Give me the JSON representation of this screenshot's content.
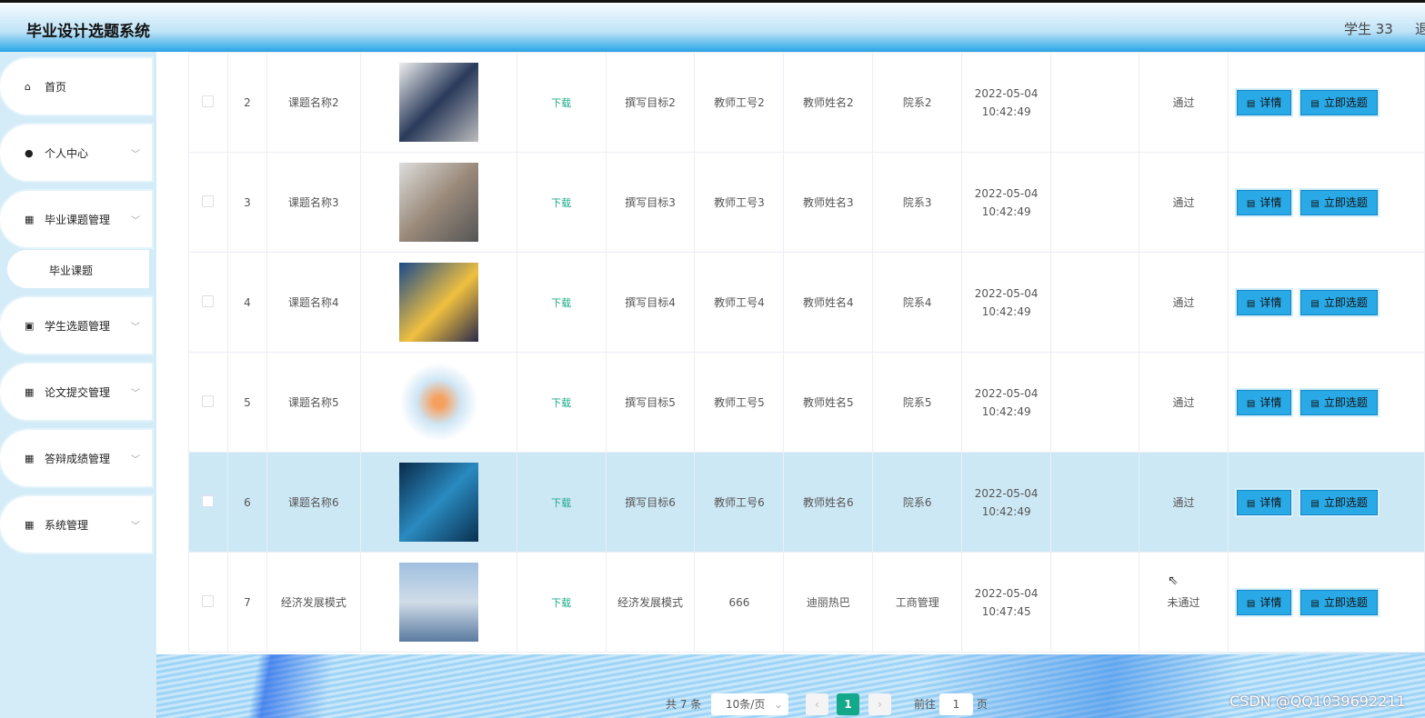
{
  "header": {
    "title": "毕业设计选题系统",
    "user": "学生 33",
    "logout": "退"
  },
  "sidebar": {
    "items": [
      {
        "label": "首页",
        "icon": "home-icon",
        "glyph": "⌂",
        "chevron": false
      },
      {
        "label": "个人中心",
        "icon": "user-icon",
        "glyph": "●",
        "chevron": true
      },
      {
        "label": "毕业课题管理",
        "icon": "grid-icon",
        "glyph": "▦",
        "chevron": true
      },
      {
        "label": "学生选题管理",
        "icon": "clipboard-icon",
        "glyph": "▣",
        "chevron": true
      },
      {
        "label": "论文提交管理",
        "icon": "grid-icon",
        "glyph": "▦",
        "chevron": true
      },
      {
        "label": "答辩成绩管理",
        "icon": "grid-icon",
        "glyph": "▦",
        "chevron": true
      },
      {
        "label": "系统管理",
        "icon": "grid-icon",
        "glyph": "▦",
        "chevron": true
      }
    ],
    "sub_item": "毕业课题"
  },
  "table": {
    "download_label": "下载",
    "detail_label": "详情",
    "select_label": "立即选题",
    "rows": [
      {
        "index": "2",
        "name": "课题名称2",
        "goal": "撰写目标2",
        "teacher_id": "教师工号2",
        "teacher_name": "教师姓名2",
        "dept": "院系2",
        "time": "2022-05-04 10:42:49",
        "status": "通过",
        "img": "linear-gradient(135deg,#eee,#2a3a5a 50%,#bbb)"
      },
      {
        "index": "3",
        "name": "课题名称3",
        "goal": "撰写目标3",
        "teacher_id": "教师工号3",
        "teacher_name": "教师姓名3",
        "dept": "院系3",
        "time": "2022-05-04 10:42:49",
        "status": "通过",
        "img": "linear-gradient(135deg,#ddd,#9a8a7a 50%,#555)"
      },
      {
        "index": "4",
        "name": "课题名称4",
        "goal": "撰写目标4",
        "teacher_id": "教师工号4",
        "teacher_name": "教师姓名4",
        "dept": "院系4",
        "time": "2022-05-04 10:42:49",
        "status": "通过",
        "img": "linear-gradient(135deg,#1a4a8a,#f0c040 55%,#2a2a4a)"
      },
      {
        "index": "5",
        "name": "课题名称5",
        "goal": "撰写目标5",
        "teacher_id": "教师工号5",
        "teacher_name": "教师姓名5",
        "dept": "院系5",
        "time": "2022-05-04 10:42:49",
        "status": "通过",
        "img": "radial-gradient(circle,#f6a060 10%,#cfe6f5 40%,#fff 70%)"
      },
      {
        "index": "6",
        "name": "课题名称6",
        "goal": "撰写目标6",
        "teacher_id": "教师工号6",
        "teacher_name": "教师姓名6",
        "dept": "院系6",
        "time": "2022-05-04 10:42:49",
        "status": "通过",
        "img": "linear-gradient(135deg,#0a2a4a,#2a8ac0 50%,#0a3050)"
      },
      {
        "index": "7",
        "name": "经济发展模式",
        "goal": "经济发展模式",
        "teacher_id": "666",
        "teacher_name": "迪丽热巴",
        "dept": "工商管理",
        "time": "2022-05-04 10:47:45",
        "status": "未通过",
        "img": "linear-gradient(#a0c0e0,#d0dce8 50%,#5a7aa0)"
      }
    ]
  },
  "pagination": {
    "total": "共 7 条",
    "page_size": "10条/页",
    "current": "1",
    "goto_label": "前往",
    "goto_value": "1",
    "page_unit": "页",
    "accent": "#13a88a"
  },
  "watermark": "CSDN @QQ1039692211"
}
